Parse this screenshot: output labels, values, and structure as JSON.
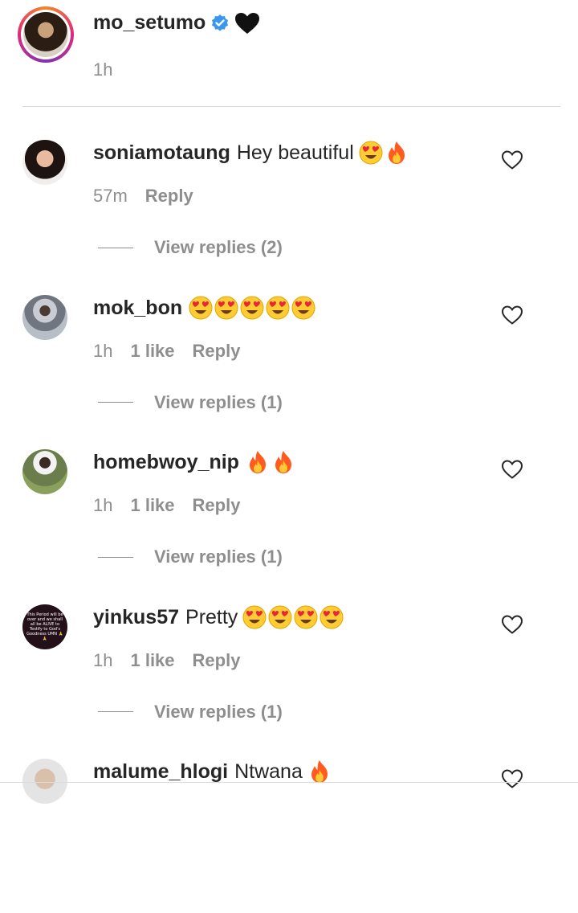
{
  "post": {
    "username": "mo_setumo",
    "time": "1h"
  },
  "comments": [
    {
      "username": "soniamotaung",
      "text": "Hey beautiful",
      "emojis": [
        "heart-eyes",
        "fire"
      ],
      "time": "57m",
      "likes": "",
      "reply_label": "Reply",
      "view_replies": "View replies (2)"
    },
    {
      "username": "mok_bon",
      "text": "",
      "emojis": [
        "heart-eyes",
        "heart-eyes",
        "heart-eyes",
        "heart-eyes",
        "heart-eyes"
      ],
      "time": "1h",
      "likes": "1 like",
      "reply_label": "Reply",
      "view_replies": "View replies (1)"
    },
    {
      "username": "homebwoy_nip",
      "text": "",
      "emojis": [
        "fire",
        "fire"
      ],
      "time": "1h",
      "likes": "1 like",
      "reply_label": "Reply",
      "view_replies": "View replies (1)"
    },
    {
      "username": "yinkus57",
      "text": "Pretty",
      "emojis": [
        "heart-eyes",
        "heart-eyes",
        "heart-eyes",
        "heart-eyes"
      ],
      "time": "1h",
      "likes": "1 like",
      "reply_label": "Reply",
      "view_replies": "View replies (1)",
      "avatar_text": "This Period will be over and we shall all be ALIVE to Testify to God's Goodness UMN 🙏🙏"
    },
    {
      "username": "malume_hlogi",
      "text": "Ntwana",
      "emojis": [
        "fire"
      ],
      "time": "",
      "likes": "",
      "reply_label": "",
      "view_replies": ""
    }
  ],
  "icons": {
    "verified": "verified-badge-icon",
    "black_heart": "black-heart-icon",
    "like": "heart-outline-icon"
  },
  "colors": {
    "verified_blue": "#3897f0",
    "muted": "#8e8e8e",
    "text": "#262626",
    "fire": "#ff5a1f",
    "emoji_face": "#ffcc33"
  }
}
